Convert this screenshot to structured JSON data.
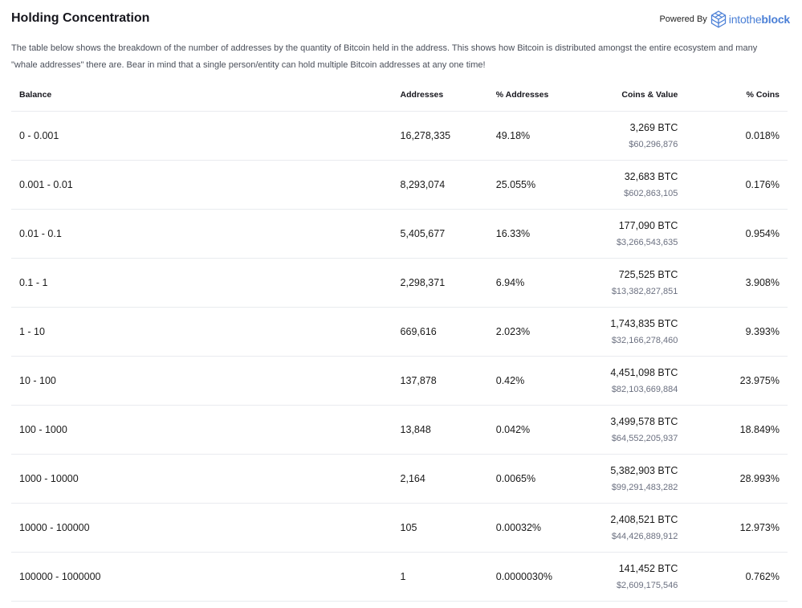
{
  "header": {
    "title": "Holding Concentration",
    "powered_by": "Powered By",
    "logo_text_light": "intothe",
    "logo_text_bold": "block"
  },
  "description": "The table below shows the breakdown of the number of addresses by the quantity of Bitcoin held in the address. This shows how Bitcoin is distributed amongst the entire ecosystem and many \"whale addresses\" there are. Bear in mind that a single person/entity can hold multiple Bitcoin addresses at any one time!",
  "table": {
    "columns": {
      "balance": "Balance",
      "addresses": "Addresses",
      "pct_addresses": "% Addresses",
      "coins_value": "Coins & Value",
      "pct_coins": "% Coins"
    },
    "rows": [
      {
        "balance": "0 - 0.001",
        "addresses": "16,278,335",
        "pct_addresses": "49.18%",
        "coins": "3,269 BTC",
        "value": "$60,296,876",
        "pct_coins": "0.018%"
      },
      {
        "balance": "0.001 - 0.01",
        "addresses": "8,293,074",
        "pct_addresses": "25.055%",
        "coins": "32,683 BTC",
        "value": "$602,863,105",
        "pct_coins": "0.176%"
      },
      {
        "balance": "0.01 - 0.1",
        "addresses": "5,405,677",
        "pct_addresses": "16.33%",
        "coins": "177,090 BTC",
        "value": "$3,266,543,635",
        "pct_coins": "0.954%"
      },
      {
        "balance": "0.1 - 1",
        "addresses": "2,298,371",
        "pct_addresses": "6.94%",
        "coins": "725,525 BTC",
        "value": "$13,382,827,851",
        "pct_coins": "3.908%"
      },
      {
        "balance": "1 - 10",
        "addresses": "669,616",
        "pct_addresses": "2.023%",
        "coins": "1,743,835 BTC",
        "value": "$32,166,278,460",
        "pct_coins": "9.393%"
      },
      {
        "balance": "10 - 100",
        "addresses": "137,878",
        "pct_addresses": "0.42%",
        "coins": "4,451,098 BTC",
        "value": "$82,103,669,884",
        "pct_coins": "23.975%"
      },
      {
        "balance": "100 - 1000",
        "addresses": "13,848",
        "pct_addresses": "0.042%",
        "coins": "3,499,578 BTC",
        "value": "$64,552,205,937",
        "pct_coins": "18.849%"
      },
      {
        "balance": "1000 - 10000",
        "addresses": "2,164",
        "pct_addresses": "0.0065%",
        "coins": "5,382,903 BTC",
        "value": "$99,291,483,282",
        "pct_coins": "28.993%"
      },
      {
        "balance": "10000 - 100000",
        "addresses": "105",
        "pct_addresses": "0.00032%",
        "coins": "2,408,521 BTC",
        "value": "$44,426,889,912",
        "pct_coins": "12.973%"
      },
      {
        "balance": "100000 - 1000000",
        "addresses": "1",
        "pct_addresses": "0.0000030%",
        "coins": "141,452 BTC",
        "value": "$2,609,175,546",
        "pct_coins": "0.762%"
      }
    ]
  },
  "icons": {
    "logo": "intotheblock-cube-icon"
  },
  "colors": {
    "brand": "#4a7fd6",
    "text": "#1a1a1a",
    "muted": "#6b7080",
    "divider": "#e9ebef"
  }
}
